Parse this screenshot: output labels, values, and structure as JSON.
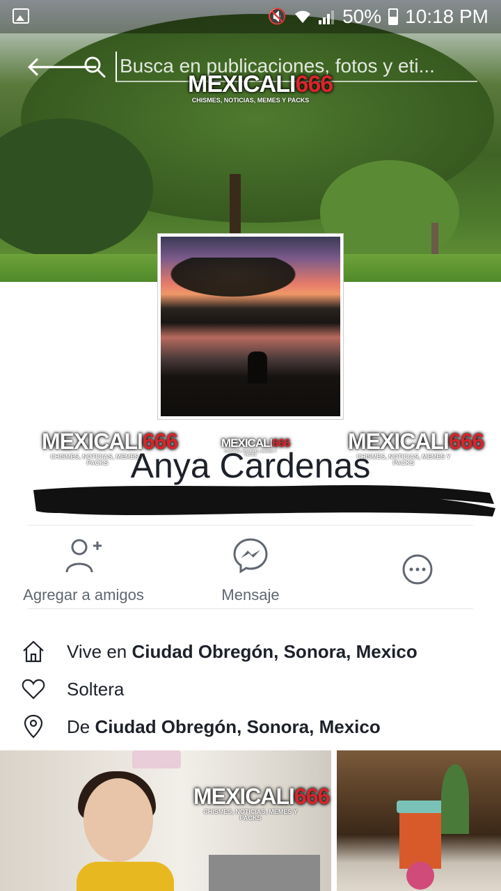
{
  "status_bar": {
    "battery": "50%",
    "time": "10:18 PM"
  },
  "search": {
    "placeholder": "Busca en publicaciones, fotos y eti..."
  },
  "watermark": {
    "brand_main": "MEXICALI",
    "brand_num": "666",
    "tagline": "CHISMES, NOTICIAS, MEMES Y PACKS"
  },
  "profile": {
    "name": "Anya Cardenas"
  },
  "actions": {
    "add_friend": "Agregar a amigos",
    "message": "Mensaje"
  },
  "intro": {
    "lives_prefix": "Vive en ",
    "lives_place": "Ciudad Obregón, Sonora, Mexico",
    "relationship": "Soltera",
    "from_prefix": "De ",
    "from_place": "Ciudad Obregón, Sonora, Mexico"
  },
  "colors": {
    "text_primary": "#1d2129",
    "text_secondary": "#606770",
    "watermark_red": "#d8262c"
  }
}
